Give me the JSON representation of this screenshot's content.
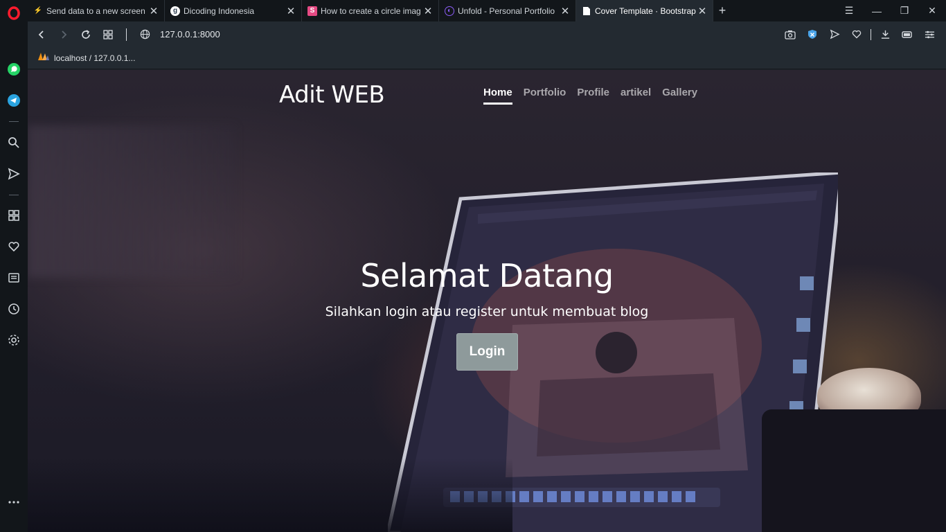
{
  "browser": {
    "tabs": [
      {
        "title": "Send data to a new screen",
        "favicon": "flutter-icon",
        "active": false
      },
      {
        "title": "Dicoding Indonesia",
        "favicon": "dicoding-icon",
        "active": false
      },
      {
        "title": "How to create a circle imag",
        "favicon": "svelte-icon",
        "active": false
      },
      {
        "title": "Unfold - Personal Portfolio",
        "favicon": "unfold-icon",
        "active": false
      },
      {
        "title": "Cover Template · Bootstrap",
        "favicon": "page-icon",
        "active": true
      }
    ],
    "new_tab": "+",
    "address": "127.0.0.1:8000",
    "bookmark": {
      "label": "localhost / 127.0.0.1..."
    },
    "sidebar_icons": [
      "opera-icon",
      "whatsapp-icon",
      "telegram-icon",
      "search-icon",
      "send-icon",
      "apps-icon",
      "heart-icon",
      "news-icon",
      "history-icon",
      "settings-icon",
      "more-icon"
    ]
  },
  "site": {
    "brand": "Adit WEB",
    "nav": [
      {
        "label": "Home",
        "active": true
      },
      {
        "label": "Portfolio",
        "active": false
      },
      {
        "label": "Profile",
        "active": false
      },
      {
        "label": "artikel",
        "active": false
      },
      {
        "label": "Gallery",
        "active": false
      }
    ],
    "hero": {
      "title": "Selamat Datang",
      "subtitle": "Silahkan login atau register untuk membuat blog",
      "button": "Login"
    }
  },
  "colors": {
    "tab_bar": "#12161a",
    "toolbar": "#232a31",
    "button_bg": "#8e9a9b",
    "whatsapp": "#25d366",
    "telegram": "#2aa3df",
    "opera": "#ff1b2d"
  }
}
